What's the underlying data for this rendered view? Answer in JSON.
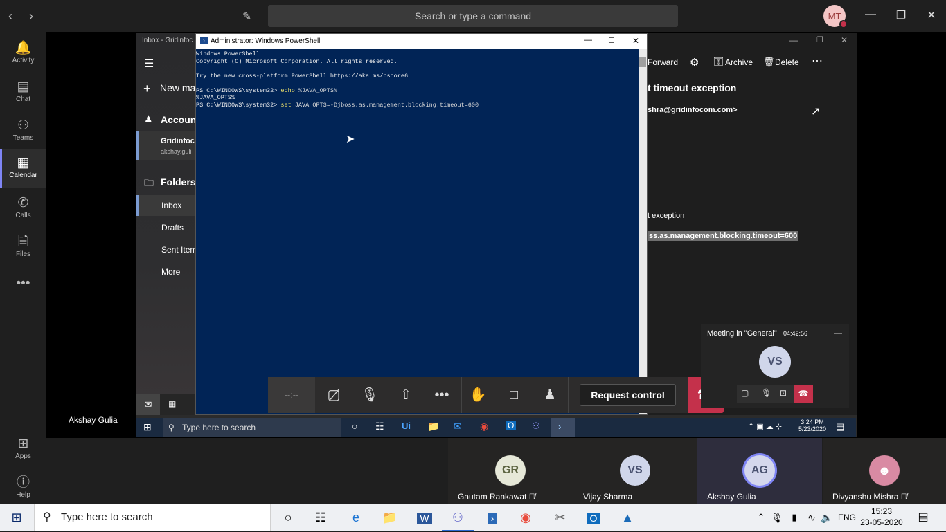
{
  "teams": {
    "search_placeholder": "Search or type a command",
    "user_initials": "MT",
    "rail": [
      {
        "label": "Activity",
        "icon": "bell-icon"
      },
      {
        "label": "Chat",
        "icon": "chat-icon"
      },
      {
        "label": "Teams",
        "icon": "teams-icon"
      },
      {
        "label": "Calendar",
        "icon": "calendar-icon"
      },
      {
        "label": "Calls",
        "icon": "phone-icon"
      },
      {
        "label": "Files",
        "icon": "file-icon"
      },
      {
        "label": "Apps",
        "icon": "apps-icon"
      },
      {
        "label": "Help",
        "icon": "help-icon"
      }
    ],
    "presenter_name": "Akshay Gulia"
  },
  "mail": {
    "window_title": "Inbox - Gridinfoc",
    "new_mail": "New ma",
    "accounts": "Account",
    "account_name": "Gridinfoc",
    "account_email": "akshay.guli",
    "folders": "Folders",
    "folder_items": [
      "Inbox",
      "Drafts",
      "Sent Item",
      "More"
    ],
    "toolbar": {
      "forward": "Forward",
      "archive": "Archive",
      "delete": "Delete"
    },
    "subject": "t timeout exception",
    "from": "shra@gridinfocom.com>",
    "body_line1": "t exception",
    "body_line2": "ss.as.management.blocking.timeout=600"
  },
  "powershell": {
    "title": "Administrator: Windows PowerShell",
    "lines": [
      "Windows PowerShell",
      "Copyright (C) Microsoft Corporation. All rights reserved.",
      "",
      "Try the new cross-platform PowerShell https://aka.ms/pscore6",
      "",
      "PS C:\\WINDOWS\\system32> ",
      "%JAVA_OPTS%",
      "PS C:\\WINDOWS\\system32> "
    ],
    "cmd1_verb": "echo",
    "cmd1_arg": " %JAVA_OPTS%",
    "cmd2_verb": "set",
    "cmd2_arg": " JAVA_OPTS=-Djboss.as.management.blocking.timeout=600"
  },
  "call": {
    "timer": "--:--",
    "request_control": "Request control"
  },
  "mini_meeting": {
    "title": "Meeting in \"General\"",
    "duration": "04:42:56",
    "initials": "VS"
  },
  "inner_taskbar": {
    "search": "Type here to search",
    "time": "3:24 PM",
    "date": "5/23/2020"
  },
  "participants": [
    {
      "name": "Gautam Rankawat",
      "initials": "GR",
      "muted": true
    },
    {
      "name": "Vijay Sharma",
      "initials": "VS",
      "muted": false
    },
    {
      "name": "Akshay Gulia",
      "initials": "AG",
      "muted": false
    },
    {
      "name": "Divyanshu Mishra",
      "initials": "",
      "muted": true
    }
  ],
  "taskbar": {
    "search": "Type here to search",
    "language": "ENG",
    "time": "15:23",
    "date": "23-05-2020"
  }
}
